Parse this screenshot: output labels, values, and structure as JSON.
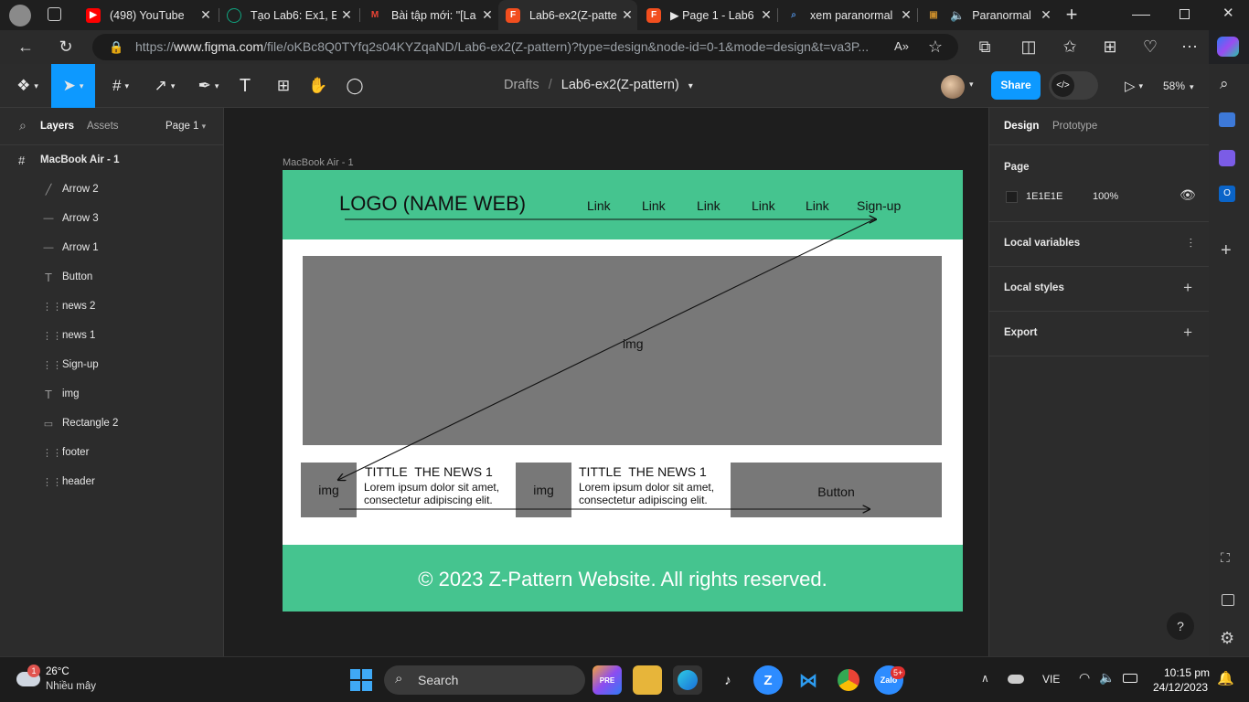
{
  "browser": {
    "tabs": [
      {
        "title": "(498) YouTube",
        "favicon": "youtube-icon",
        "color": "#ff0000"
      },
      {
        "title": "Tạo Lab6: Ex1, Ex",
        "favicon": "chatgpt-icon",
        "color": "#10a37f"
      },
      {
        "title": "Bài tập mới: \"[La",
        "favicon": "gmail-icon",
        "color": "#ea4335"
      },
      {
        "title": "Lab6-ex2(Z-patte",
        "favicon": "figma-icon",
        "color": "#f24e1e",
        "active": true
      },
      {
        "title": "▶ Page 1 - Lab6",
        "favicon": "figma-icon",
        "color": "#f24e1e"
      },
      {
        "title": "xem paranormal",
        "favicon": "search-icon",
        "color": "#4f8bd6"
      },
      {
        "title": "Paranormal",
        "favicon": "movie-icon",
        "color": "#c78b2a"
      }
    ],
    "url_prefix": "https://",
    "url_domain": "www.figma.com",
    "url_rest": "/file/oKBc8Q0TYfq2s04KYZqaND/Lab6-ex2(Z-pattern)?type=design&node-id=0-1&mode=design&t=va3P..."
  },
  "figma": {
    "breadcrumb_drafts": "Drafts",
    "breadcrumb_sep": "/",
    "file_name": "Lab6-ex2(Z-pattern)",
    "share_label": "Share",
    "zoom": "58%",
    "left_tabs": {
      "layers": "Layers",
      "assets": "Assets",
      "page": "Page 1"
    },
    "frame_name": "MacBook Air - 1",
    "layers": [
      {
        "name": "Arrow 2",
        "icon": "arrow-icon"
      },
      {
        "name": "Arrow 3",
        "icon": "line-icon"
      },
      {
        "name": "Arrow 1",
        "icon": "line-icon"
      },
      {
        "name": "Button",
        "icon": "text-icon"
      },
      {
        "name": "news 2",
        "icon": "frame-icon"
      },
      {
        "name": "news 1",
        "icon": "frame-icon"
      },
      {
        "name": "Sign-up",
        "icon": "frame-icon"
      },
      {
        "name": "img",
        "icon": "text-icon"
      },
      {
        "name": "Rectangle 2",
        "icon": "rectangle-icon"
      },
      {
        "name": "footer",
        "icon": "frame-icon"
      },
      {
        "name": "header",
        "icon": "frame-icon"
      }
    ],
    "right_tabs": {
      "design": "Design",
      "prototype": "Prototype"
    },
    "page_section": {
      "label": "Page",
      "color_hex": "1E1E1E",
      "opacity": "100%"
    },
    "sections": [
      "Local variables",
      "Local styles",
      "Export"
    ],
    "help": "?"
  },
  "design": {
    "frame_label": "MacBook Air - 1",
    "logo": "LOGO (NAME WEB)",
    "nav_links": [
      "Link",
      "Link",
      "Link",
      "Link",
      "Link"
    ],
    "signup": "Sign-up",
    "hero_img": "img",
    "news": [
      {
        "img": "img",
        "title": "TITTLE  THE NEWS 1",
        "body1": "Lorem ipsum dolor sit amet,",
        "body2": "consectetur adipiscing elit."
      },
      {
        "img": "img",
        "title": "TITTLE  THE NEWS 1",
        "body1": "Lorem ipsum dolor sit amet,",
        "body2": "consectetur adipiscing elit."
      }
    ],
    "button": "Button",
    "footer": "© 2023 Z-Pattern Website. All rights reserved.",
    "colors": {
      "green": "#45c48f",
      "gray": "#787878",
      "canvas": "#1e1e1e"
    }
  },
  "taskbar": {
    "weather_temp": "26°C",
    "weather_desc": "Nhiều mây",
    "weather_badge": "1",
    "search": "Search",
    "lang": "VIE",
    "time": "10:15 pm",
    "date": "24/12/2023",
    "zalo_badge": "5+"
  }
}
